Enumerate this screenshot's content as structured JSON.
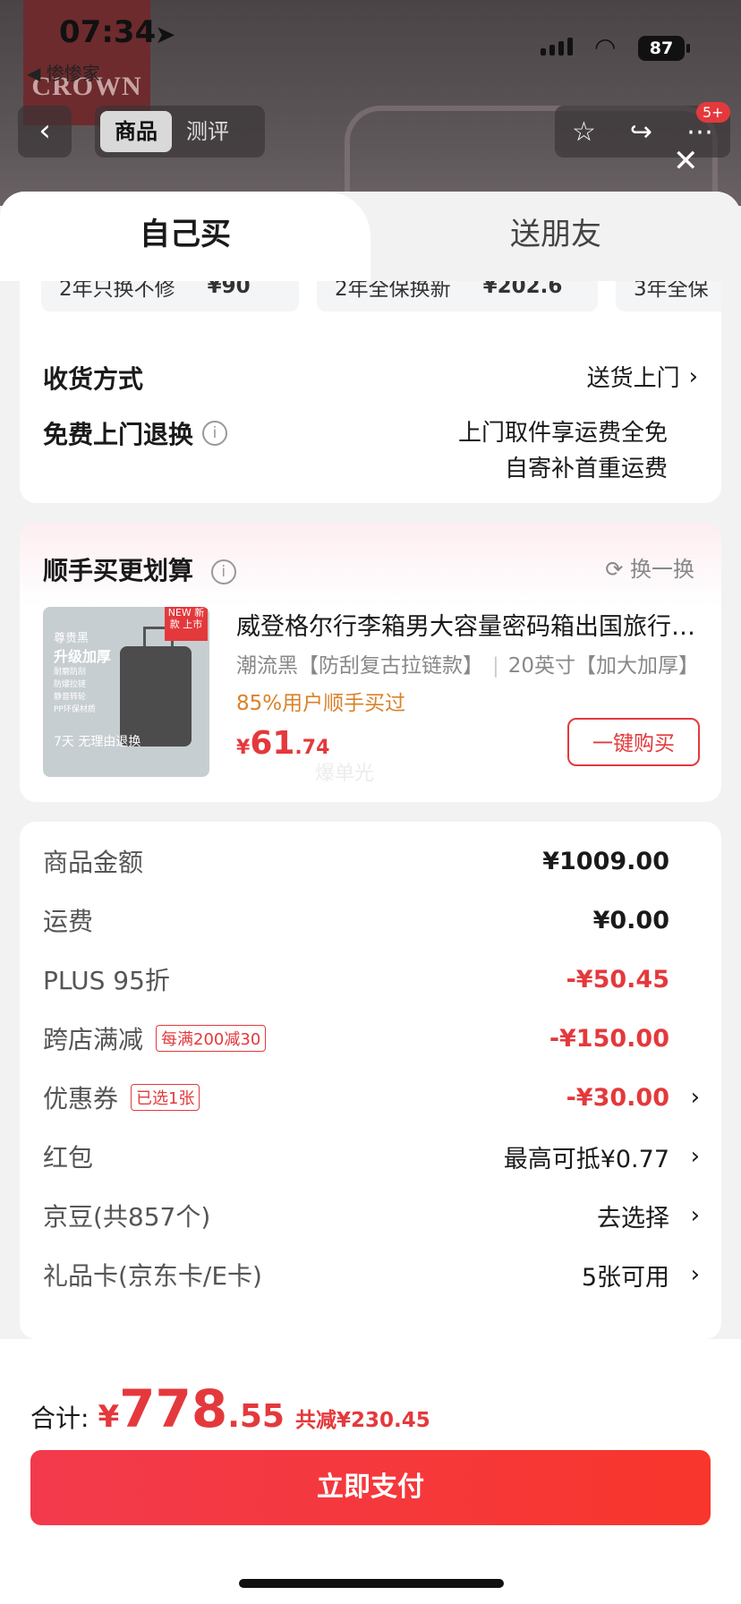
{
  "status": {
    "time": "07:34",
    "back_app": "◀ 惨惨家",
    "battery": "87"
  },
  "background": {
    "brand_logo": "CROWN"
  },
  "nav": {
    "tabs": [
      {
        "label": "商品"
      },
      {
        "label": "测评"
      }
    ],
    "badge": "5+"
  },
  "sheet": {
    "tabs": {
      "self": "自己买",
      "friend": "送朋友"
    },
    "services": [
      {
        "label": "2年只换不修",
        "price": "¥90"
      },
      {
        "label": "2年全保换新",
        "price": "¥202.6"
      },
      {
        "label": "3年全保"
      }
    ],
    "delivery": {
      "label": "收货方式",
      "value": "送货上门"
    },
    "return": {
      "label": "免费上门退换",
      "line1": "上门取件享运费全免",
      "line2": "自寄补首重运费"
    }
  },
  "addon": {
    "title": "顺手买更划算",
    "swap": "换一换",
    "image": {
      "tag": "NEW 新款 上市",
      "lines": [
        "尊贵黑",
        "升级加厚",
        "耐磨防刮",
        "防爆拉链",
        "静音转轮",
        "PP环保材质"
      ],
      "days": "7天 无理由退换"
    },
    "product_name": "威登格尔行李箱男大容量密码箱出国旅行拉杆箱",
    "spec1": "潮流黑【防刮复古拉链款】",
    "spec2": "20英寸【加大加厚】",
    "bought": "85%用户顺手买过",
    "price_currency": "¥",
    "price_int": "61",
    "price_dec": ".74",
    "watermark": "爆单光",
    "buy_button": "一键购买"
  },
  "pricing": {
    "rows": [
      {
        "label": "商品金额",
        "value": "¥1009.00"
      },
      {
        "label": "运费",
        "value": "¥0.00"
      },
      {
        "label": "PLUS 95折",
        "value": "-¥50.45"
      },
      {
        "label": "跨店满减",
        "tag": "每满200减30",
        "value": "-¥150.00"
      },
      {
        "label": "优惠券",
        "tag": "已选1张",
        "value": "-¥30.00"
      },
      {
        "label": "红包",
        "value": "最高可抵¥0.77"
      },
      {
        "label": "京豆(共857个)",
        "value": "去选择"
      },
      {
        "label": "礼品卡(京东卡/E卡)",
        "value": "5张可用"
      }
    ]
  },
  "footer": {
    "total_label": "合计:",
    "currency": "¥",
    "total_int": "778",
    "total_dec": ".55",
    "saved": "共减¥230.45",
    "pay_button": "立即支付"
  },
  "colors": {
    "accent": "#e4393c",
    "orange": "#d9822b",
    "pay_gradient_start": "#f23a4d",
    "pay_gradient_end": "#f8362c"
  }
}
